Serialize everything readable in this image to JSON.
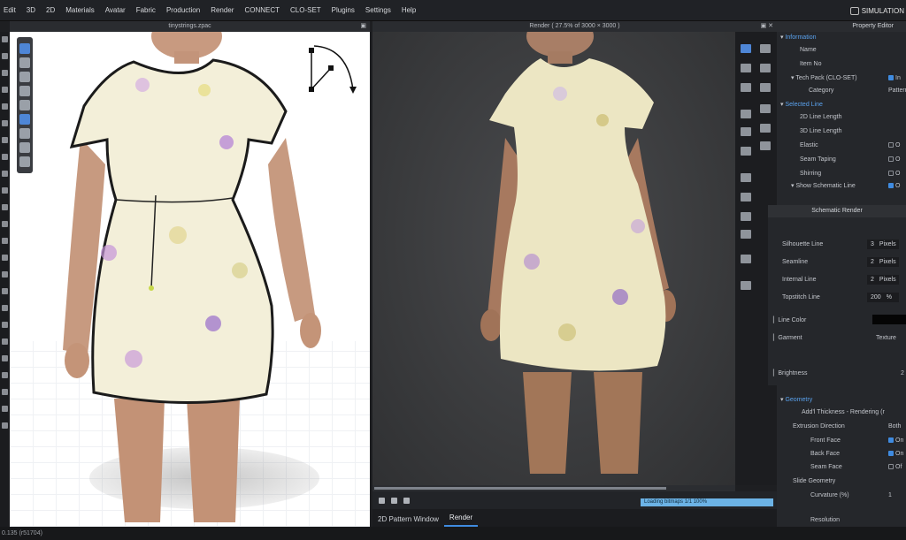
{
  "menu": [
    "Edit",
    "3D",
    "2D",
    "Materials",
    "Avatar",
    "Fabric",
    "Production",
    "Render",
    "CONNECT",
    "CLO-SET",
    "Plugins",
    "Settings",
    "Help"
  ],
  "mode_label": "SIMULATION",
  "viewport3d": {
    "filename": "tinystrings.zpac"
  },
  "render_view": {
    "title": "Render ( 27.5% of 3000 × 3000 )",
    "progress_text": "Loading bitmaps 1/1 100%",
    "progress_pct": 100
  },
  "bottom_tabs": [
    "2D Pattern Window",
    "Render"
  ],
  "property_editor": {
    "title": "Property Editor",
    "rows": [
      {
        "label": "Information",
        "type": "section"
      },
      {
        "label": "Name",
        "type": "field"
      },
      {
        "label": "Item No",
        "type": "field"
      },
      {
        "label": "Tech Pack (CLO-SET)",
        "type": "check",
        "checked": true,
        "value": "In"
      },
      {
        "label": "Category",
        "type": "field",
        "value": "Pattern"
      },
      {
        "label": "Selected Line",
        "type": "section"
      },
      {
        "label": "2D Line Length",
        "type": "field"
      },
      {
        "label": "3D Line Length",
        "type": "field"
      },
      {
        "label": "Elastic",
        "type": "check",
        "checked": false,
        "value": "O"
      },
      {
        "label": "Seam Taping",
        "type": "check",
        "checked": false,
        "value": "O"
      },
      {
        "label": "Shirring",
        "type": "check",
        "checked": false,
        "value": "O"
      },
      {
        "label": "Show Schematic Line",
        "type": "check",
        "checked": true,
        "value": "O"
      }
    ]
  },
  "schematic_render": {
    "title": "Schematic Render",
    "rows": [
      {
        "label": "Silhouette Line",
        "value": "3",
        "unit": "Pixels"
      },
      {
        "label": "Seamline",
        "value": "2",
        "unit": "Pixels"
      },
      {
        "label": "Internal Line",
        "value": "2",
        "unit": "Pixels"
      },
      {
        "label": "Topstitch Line",
        "value": "200",
        "unit": "%"
      }
    ],
    "line_color_label": "Line Color",
    "line_color": "#050505",
    "garment_label": "Garment",
    "garment_value": "Texture",
    "brightness_label": "Brightness",
    "brightness_value": "2"
  },
  "geometry": {
    "title": "Geometry",
    "rows": [
      {
        "label": "Add'l Thickness - Rendering (r",
        "value": ""
      },
      {
        "label": "Extrusion Direction",
        "value": "Both"
      },
      {
        "label": "Front Face",
        "value": "On",
        "checked": true
      },
      {
        "label": "Back Face",
        "value": "On",
        "checked": true
      },
      {
        "label": "Seam Face",
        "value": "Of",
        "checked": false
      },
      {
        "label": "Slide Geometry",
        "value": ""
      },
      {
        "label": "Curvature (%)",
        "value": "1"
      },
      {
        "label": "Resolution",
        "value": ""
      }
    ]
  },
  "status": "0.135 (r51704)",
  "colors": {
    "accent": "#3f8be0",
    "section": "#5aa2ee"
  }
}
